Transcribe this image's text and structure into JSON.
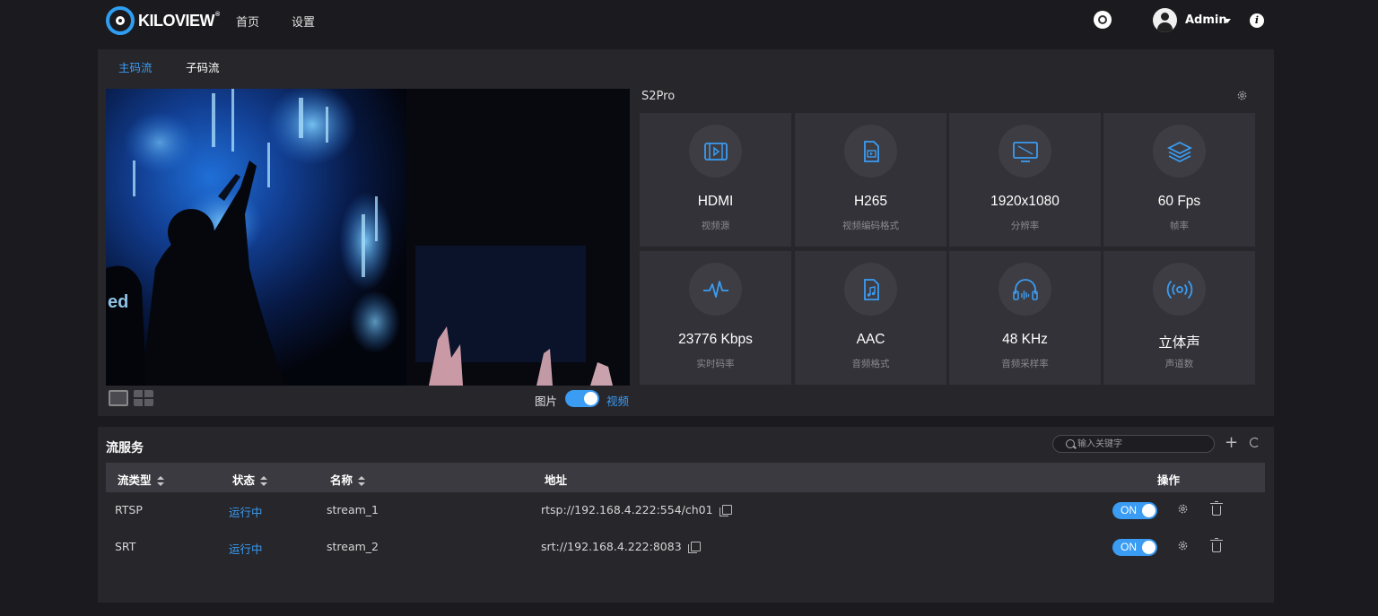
{
  "header": {
    "logo_text": "KILOVIEW",
    "logo_mark": "®",
    "nav": [
      {
        "label": "首页"
      },
      {
        "label": "设置"
      }
    ],
    "user": "Admin",
    "info_symbol": "i"
  },
  "stream_tabs": [
    {
      "label": "主码流",
      "active": true
    },
    {
      "label": "子码流",
      "active": false
    }
  ],
  "preview": {
    "mode_left": "图片",
    "mode_right": "视频",
    "video_mode_on": true
  },
  "device": {
    "name": "S2Pro",
    "stats": [
      {
        "value": "HDMI",
        "caption": "视频源",
        "icon": "film-icon"
      },
      {
        "value": "H265",
        "caption": "视频编码格式",
        "icon": "video-file-icon"
      },
      {
        "value": "1920x1080",
        "caption": "分辨率",
        "icon": "monitor-icon"
      },
      {
        "value": "60 Fps",
        "caption": "帧率",
        "icon": "layers-icon"
      },
      {
        "value": "23776 Kbps",
        "caption": "实时码率",
        "icon": "pulse-icon"
      },
      {
        "value": "AAC",
        "caption": "音频格式",
        "icon": "music-file-icon"
      },
      {
        "value": "48 KHz",
        "caption": "音频采样率",
        "icon": "headphones-icon"
      },
      {
        "value": "立体声",
        "caption": "声道数",
        "icon": "broadcast-icon"
      }
    ]
  },
  "stream_service": {
    "title": "流服务",
    "search_placeholder": "输入关键字",
    "add_symbol": "+",
    "columns": [
      "流类型",
      "状态",
      "名称",
      "地址",
      "操作"
    ],
    "rows": [
      {
        "type": "RTSP",
        "status": "运行中",
        "name": "stream_1",
        "address": "rtsp://192.168.4.222:554/ch01",
        "toggle": "ON"
      },
      {
        "type": "SRT",
        "status": "运行中",
        "name": "stream_2",
        "address": "srt://192.168.4.222:8083",
        "toggle": "ON"
      }
    ]
  },
  "colors": {
    "accent": "#3b9cf3",
    "background": "#1b1b1f",
    "panel": "#26262b",
    "tile": "#323238"
  }
}
